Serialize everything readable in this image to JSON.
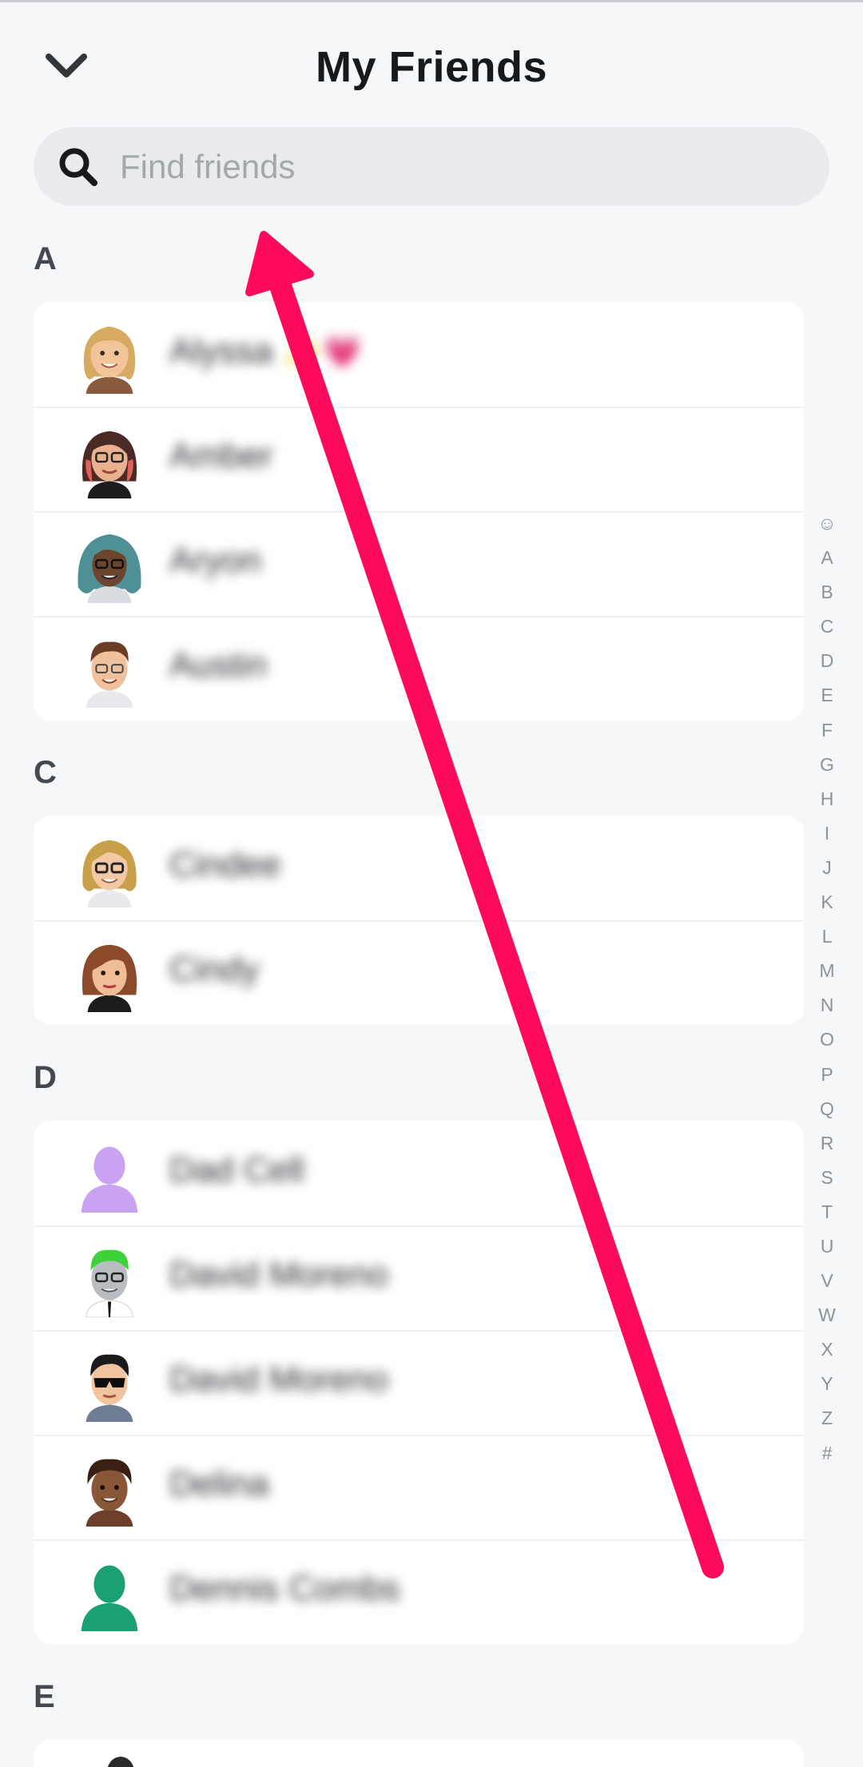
{
  "header": {
    "title": "My Friends",
    "back_icon": "chevron-down-icon"
  },
  "search": {
    "placeholder": "Find friends",
    "value": "",
    "icon": "search-icon"
  },
  "sections": [
    {
      "letter": "A",
      "friends": [
        {
          "name": "Alyssa",
          "emoji": "✨💗",
          "avatar": "bitmoji-blonde-woman"
        },
        {
          "name": "Amber",
          "avatar": "bitmoji-woman-glasses-redhair"
        },
        {
          "name": "Aryon",
          "avatar": "bitmoji-teal-hair-glasses"
        },
        {
          "name": "Austin",
          "avatar": "bitmoji-man-glasses"
        }
      ]
    },
    {
      "letter": "C",
      "friends": [
        {
          "name": "Cindee",
          "avatar": "bitmoji-blonde-glasses"
        },
        {
          "name": "Cindy",
          "avatar": "bitmoji-brown-hair-woman"
        }
      ]
    },
    {
      "letter": "D",
      "friends": [
        {
          "name": "Dad Cell",
          "avatar": "default-silhouette-purple"
        },
        {
          "name": "David Moreno",
          "avatar": "bitmoji-green-hair-man"
        },
        {
          "name": "David Moreno",
          "avatar": "bitmoji-sunglasses-man"
        },
        {
          "name": "Delina",
          "avatar": "bitmoji-curly-hair-woman"
        },
        {
          "name": "Dennis Combs",
          "avatar": "default-silhouette-green"
        }
      ]
    },
    {
      "letter": "E",
      "friends": []
    }
  ],
  "index": [
    "☺",
    "A",
    "B",
    "C",
    "D",
    "E",
    "F",
    "G",
    "H",
    "I",
    "J",
    "K",
    "L",
    "M",
    "N",
    "O",
    "P",
    "Q",
    "R",
    "S",
    "T",
    "U",
    "V",
    "W",
    "X",
    "Y",
    "Z",
    "#"
  ],
  "colors": {
    "background": "#f6f7f9",
    "card": "#ffffff",
    "annotation_arrow": "#fd0a5a"
  }
}
